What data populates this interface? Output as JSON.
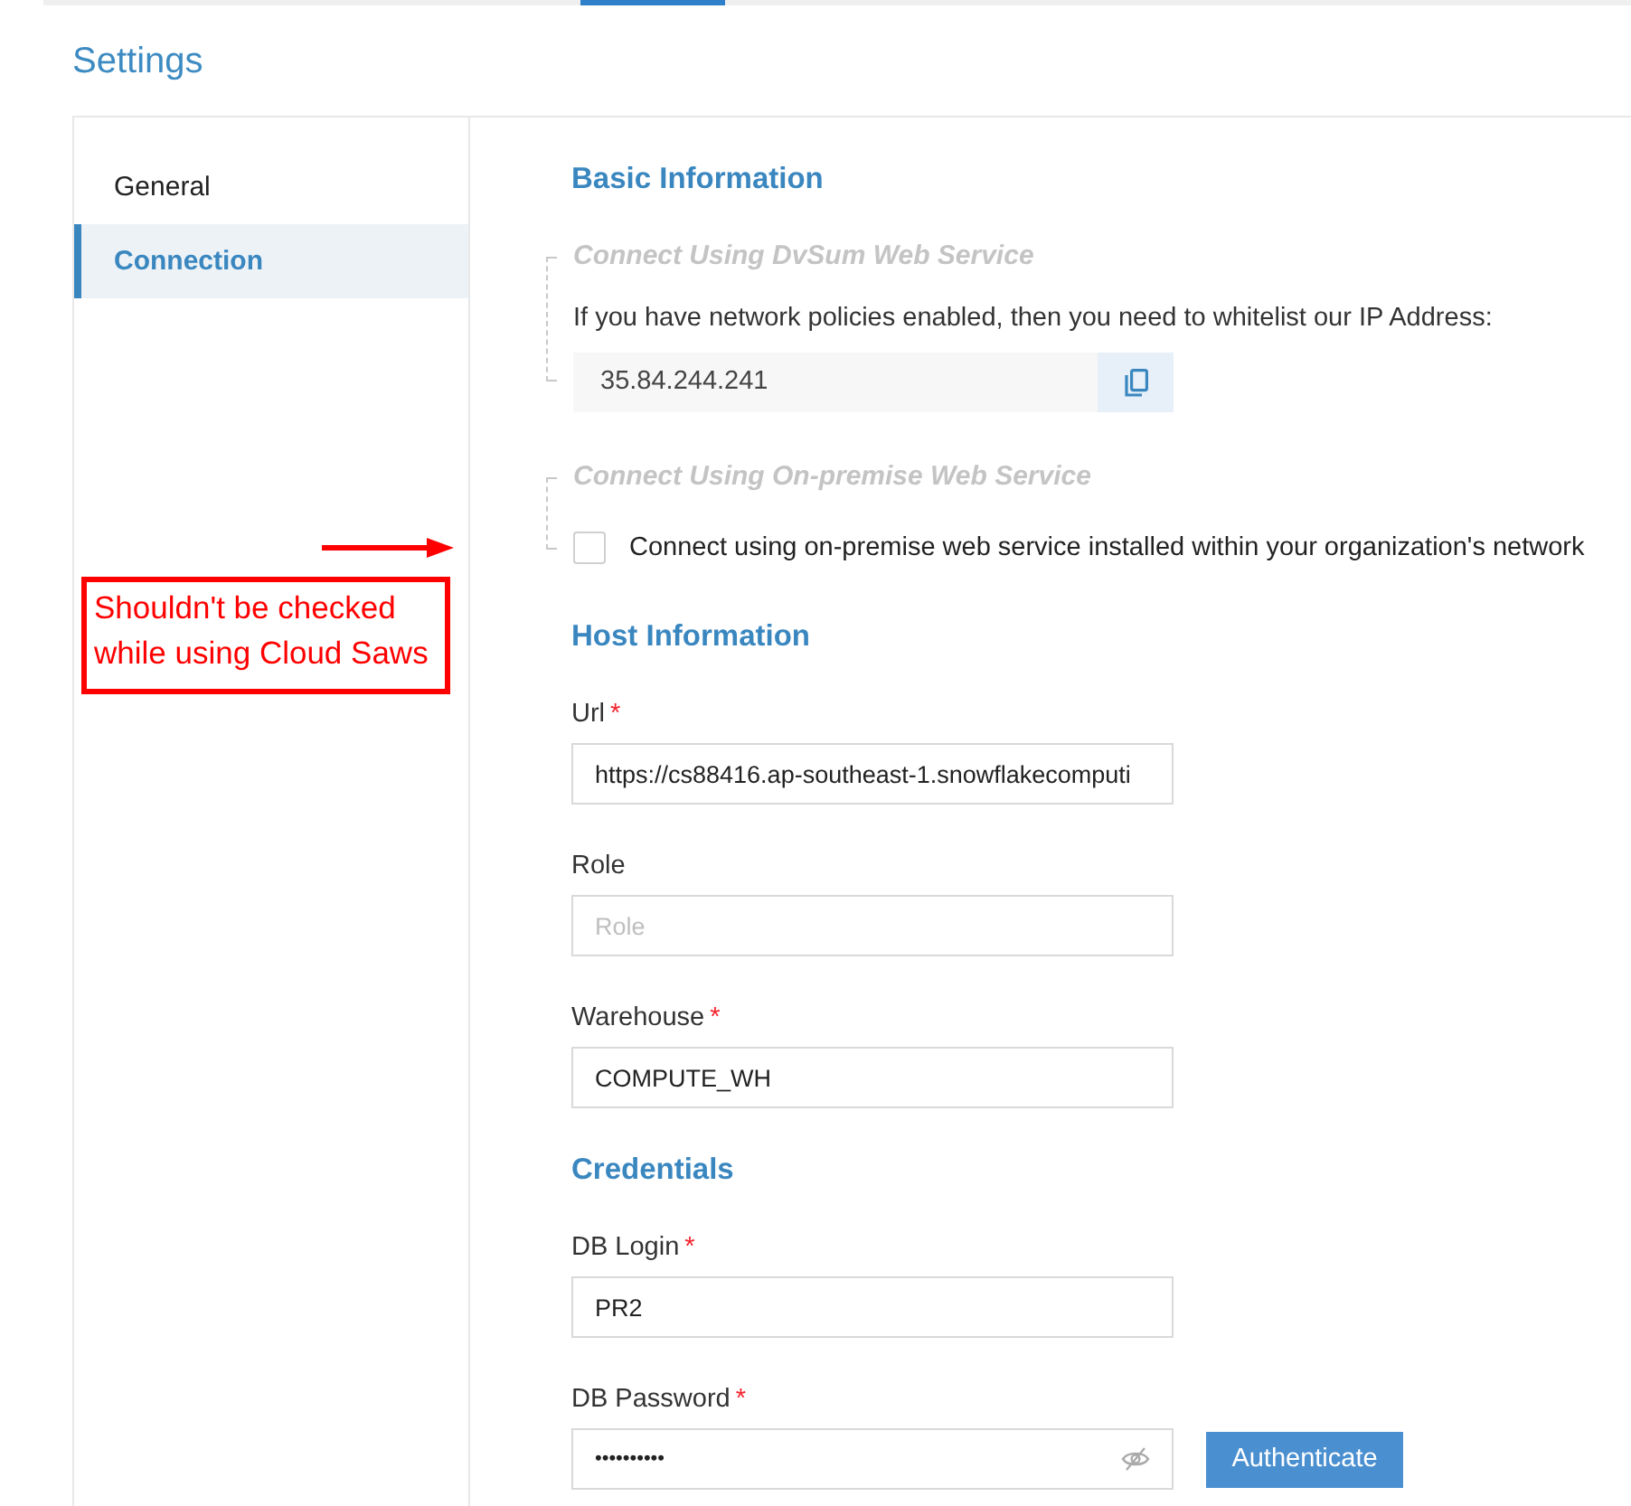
{
  "page": {
    "title": "Settings"
  },
  "sidebar": {
    "items": [
      {
        "label": "General",
        "selected": false
      },
      {
        "label": "Connection",
        "selected": true
      }
    ]
  },
  "basic_information": {
    "heading": "Basic Information",
    "options": [
      {
        "kind": "ip_address",
        "title": "Connect Using DvSum Web Service",
        "description": "If you have network policies enabled, then you need to whitelist our IP Address:",
        "ip_address": "35.84.244.241"
      },
      {
        "kind": "checkbox",
        "title": "Connect Using On-premise Web Service",
        "checkbox": {
          "label": "Connect using on-premise web service installed within your organization's network",
          "checked": false
        }
      }
    ]
  },
  "host_information": {
    "heading": "Host Information",
    "fields": [
      {
        "kind": "text",
        "label": "Url",
        "required_mark": "*",
        "value": "https://cs88416.ap-southeast-1.snowflakecomputi"
      },
      {
        "kind": "text",
        "label": "Role",
        "placeholder": "Role"
      },
      {
        "kind": "text",
        "label": "Warehouse",
        "required_mark": "*",
        "value": "COMPUTE_WH"
      }
    ]
  },
  "credentials": {
    "heading": "Credentials",
    "fields": [
      {
        "kind": "text",
        "label": "DB Login",
        "required_mark": "*",
        "value": "PR2"
      },
      {
        "kind": "password",
        "label": "DB Password",
        "required_mark": "*",
        "value": "••••••••••"
      }
    ],
    "button": "Authenticate"
  },
  "annotation": {
    "lines": [
      "Shouldn't be checked",
      "while using Cloud Saws"
    ]
  }
}
